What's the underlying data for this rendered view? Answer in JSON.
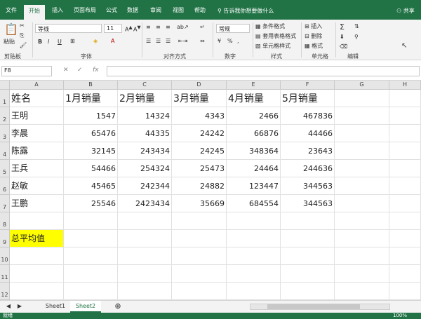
{
  "ribbon_tabs": [
    "文件",
    "开始",
    "插入",
    "页面布局",
    "公式",
    "数据",
    "审阅",
    "视图",
    "帮助"
  ],
  "active_tab": "开始",
  "tell_me": "告诉我你想要做什么",
  "share": "共享",
  "ribbon": {
    "paste": "粘贴",
    "font_name": "等线",
    "font_size": "11",
    "number_format": "常规",
    "cond_format": "条件格式",
    "table_format": "套用表格格式",
    "cell_style": "单元格样式",
    "insert": "插入",
    "delete": "删除",
    "format": "格式",
    "groups": {
      "clipboard": "剪贴板",
      "font": "字体",
      "align": "对齐方式",
      "number": "数字",
      "style": "样式",
      "cells": "单元格",
      "edit": "编辑"
    }
  },
  "name_box": "F8",
  "fx": "fx",
  "columns": [
    "A",
    "B",
    "C",
    "D",
    "E",
    "F",
    "G",
    "H"
  ],
  "rows": [
    "1",
    "2",
    "3",
    "4",
    "5",
    "6",
    "7",
    "8",
    "9",
    "10",
    "11",
    "12"
  ],
  "headers": [
    "姓名",
    "1月销量",
    "2月销量",
    "3月销量",
    "4月销量",
    "5月销量"
  ],
  "records": [
    [
      "王明",
      "1547",
      "14324",
      "4343",
      "2466",
      "467836"
    ],
    [
      "李晨",
      "65476",
      "44335",
      "24242",
      "66876",
      "44466"
    ],
    [
      "陈露",
      "32145",
      "243434",
      "24245",
      "348364",
      "23643"
    ],
    [
      "王兵",
      "54466",
      "254324",
      "25473",
      "24464",
      "244636"
    ],
    [
      "赵敏",
      "45465",
      "242344",
      "24882",
      "123447",
      "344563"
    ],
    [
      "王鹏",
      "25546",
      "2423434",
      "35669",
      "684554",
      "344563"
    ]
  ],
  "average_label": "总平均值",
  "highlight_color": "#ffff00",
  "sheets": [
    "Sheet1",
    "Sheet2"
  ],
  "active_sheet": "Sheet2",
  "status_text": "就绪",
  "zoom": "100%"
}
